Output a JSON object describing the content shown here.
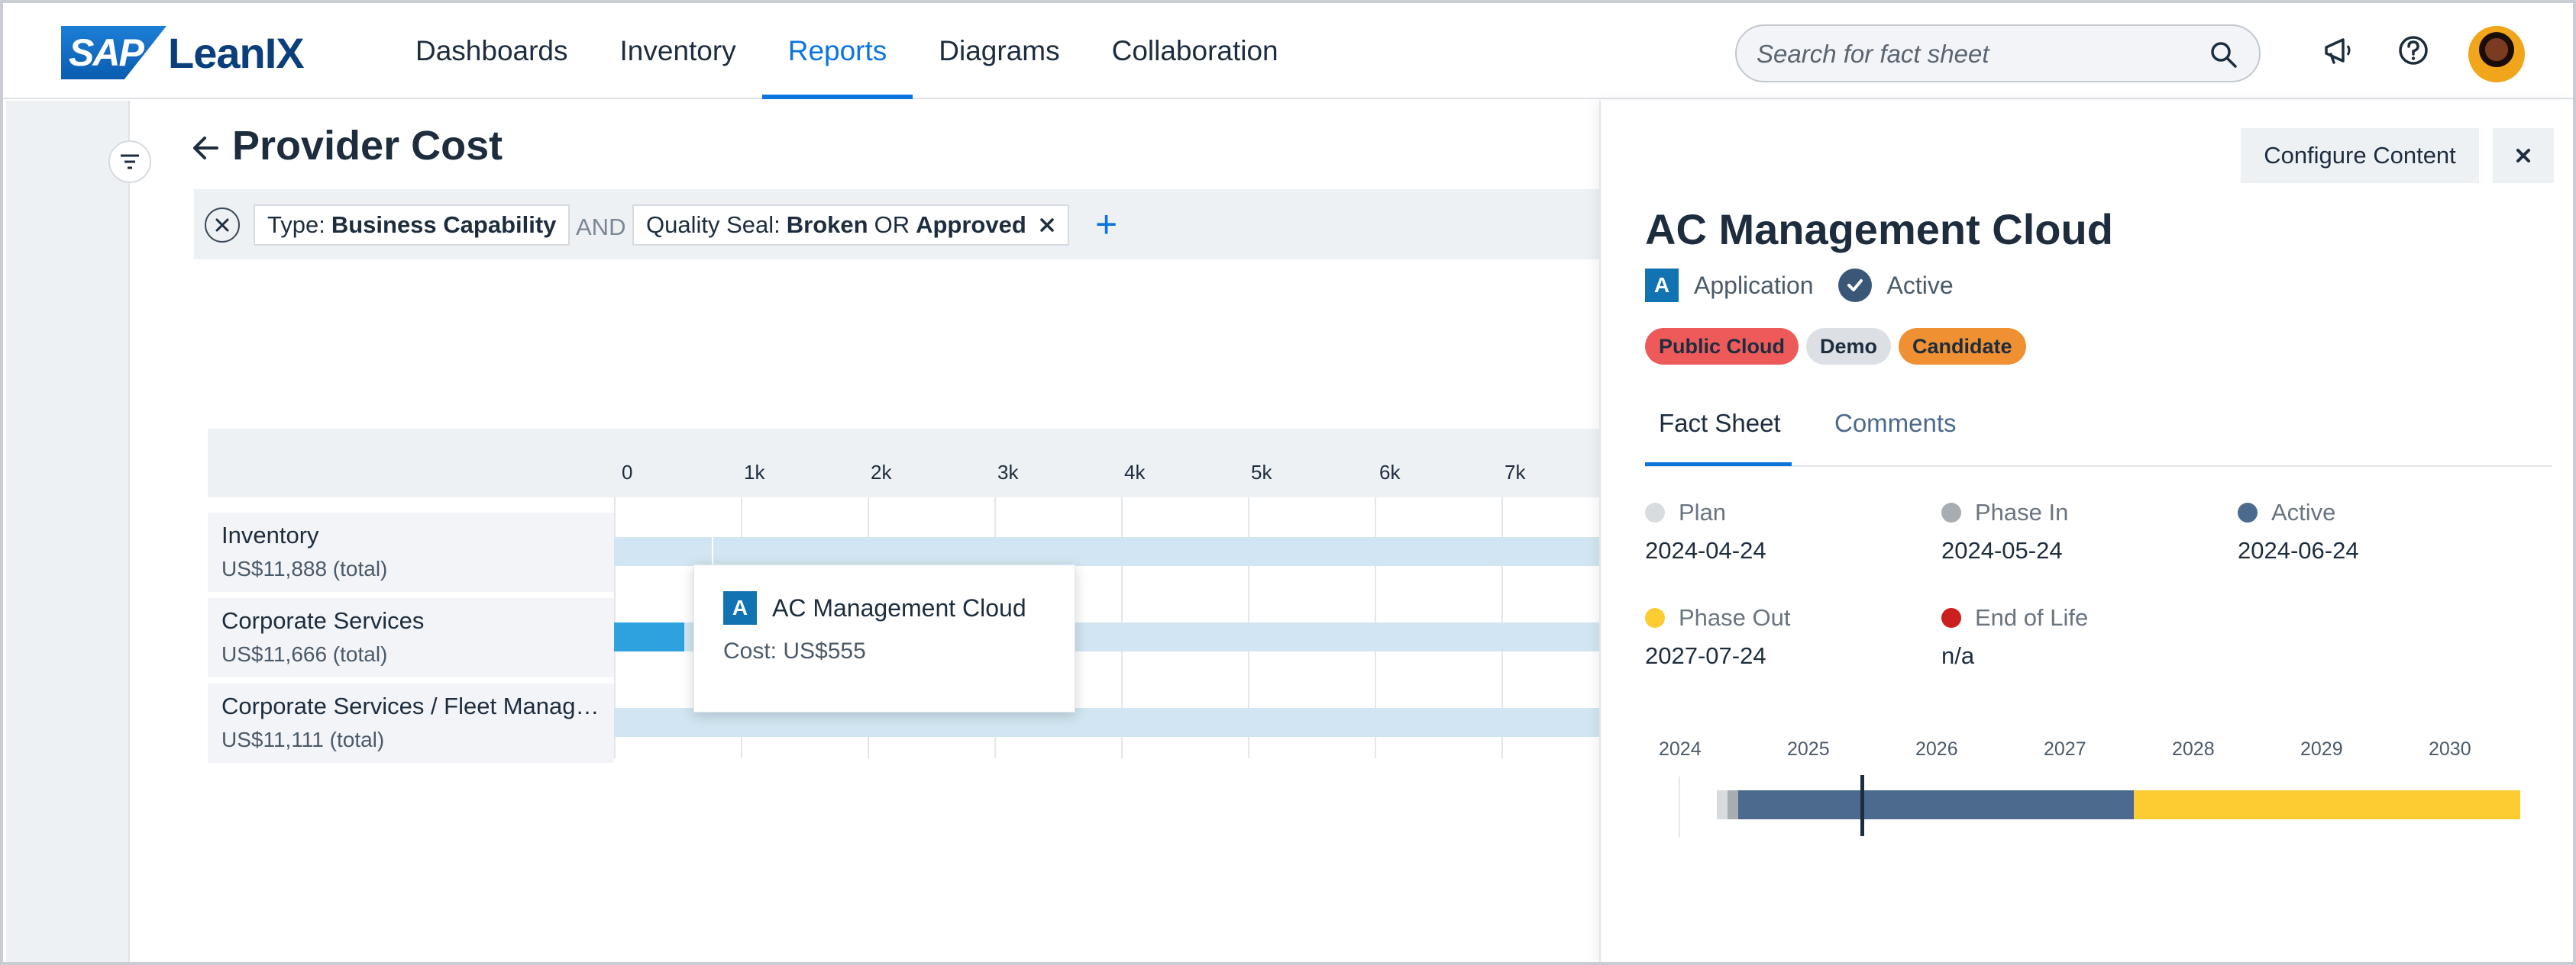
{
  "header": {
    "logo_sap": "SAP",
    "logo_product": "LeanIX",
    "nav": [
      {
        "label": "Dashboards"
      },
      {
        "label": "Inventory"
      },
      {
        "label": "Reports",
        "active": true
      },
      {
        "label": "Diagrams"
      },
      {
        "label": "Collaboration"
      }
    ],
    "search_placeholder": "Search for fact sheet",
    "icons": [
      "search-icon",
      "megaphone-icon",
      "help-icon",
      "avatar"
    ]
  },
  "report": {
    "title": "Provider Cost",
    "filters": {
      "chip1_key": "Type:",
      "chip1_value": "Business Capability",
      "op_and": "AND",
      "chip2_key": "Quality Seal:",
      "chip2_value1": "Broken",
      "chip2_or": "OR",
      "chip2_value2": "Approved"
    },
    "axis_ticks": [
      "0",
      "1k",
      "2k",
      "3k",
      "4k",
      "5k",
      "6k",
      "7k"
    ],
    "rows": [
      {
        "name": "Inventory",
        "total": "US$11,888 (total)"
      },
      {
        "name": "Corporate Services",
        "total": "US$11,666 (total)"
      },
      {
        "name": "Corporate Services / Fleet Manage...",
        "total": "US$11,111 (total)"
      }
    ],
    "tooltip": {
      "badge": "A",
      "name": "AC Management Cloud",
      "cost": "Cost: US$555"
    }
  },
  "panel": {
    "configure_label": "Configure Content",
    "title": "AC Management Cloud",
    "type_badge": "A",
    "type_label": "Application",
    "status_label": "Active",
    "tags": [
      {
        "label": "Public Cloud",
        "color": "#ee5a5a"
      },
      {
        "label": "Demo",
        "color": "#dcdfe3"
      },
      {
        "label": "Candidate",
        "color": "#ef9033"
      }
    ],
    "tabs": [
      {
        "label": "Fact Sheet",
        "active": true
      },
      {
        "label": "Comments"
      }
    ],
    "lifecycle": [
      {
        "phase": "Plan",
        "date": "2024-04-24",
        "color": "#d9dcdf"
      },
      {
        "phase": "Phase In",
        "date": "2024-05-24",
        "color": "#a8adb2"
      },
      {
        "phase": "Active",
        "date": "2024-06-24",
        "color": "#4b6a8d"
      },
      {
        "phase": "Phase Out",
        "date": "2027-07-24",
        "color": "#fdcb32"
      },
      {
        "phase": "End of Life",
        "date": "n/a",
        "color": "#cc1f1f"
      }
    ],
    "timeline_years": [
      "2024",
      "2025",
      "2026",
      "2027",
      "2028",
      "2029",
      "2030"
    ]
  }
}
